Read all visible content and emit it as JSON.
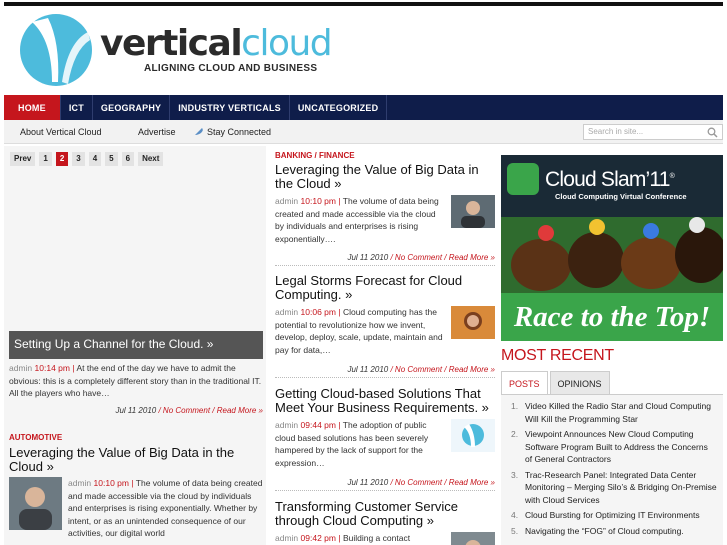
{
  "brand": {
    "word_part1": "vertical",
    "word_part2": "cloud",
    "tagline": "ALIGNING CLOUD AND BUSINESS"
  },
  "nav": {
    "items": [
      {
        "label": "HOME",
        "active": true
      },
      {
        "label": "ICT"
      },
      {
        "label": "GEOGRAPHY"
      },
      {
        "label": "INDUSTRY VERTICALS"
      },
      {
        "label": "UNCATEGORIZED"
      }
    ]
  },
  "subnav": {
    "about": "About Vertical Cloud",
    "advertise": "Advertise",
    "connected": "Stay Connected",
    "search_placeholder": "Search in site..."
  },
  "pager": {
    "prev": "Prev",
    "pages": [
      "1",
      "2",
      "3",
      "4",
      "5",
      "6"
    ],
    "current": "2",
    "next": "Next"
  },
  "slider": {
    "caption": "Setting Up a Channel for the Cloud. »",
    "author": "admin",
    "time": "10:14 pm",
    "excerpt": "At the end of the day we have to admit the obvious: this is a completely different story than in the traditional IT. All the players who have…",
    "date": "Jul 11 2010",
    "comments": "No Comment",
    "read_more": "Read More »"
  },
  "left_post": {
    "category": "AUTOMOTIVE",
    "title": "Leveraging the Value of Big Data in the Cloud »",
    "author": "admin",
    "time": "10:10 pm",
    "excerpt": "The volume of data being created and made accessible via the cloud by individuals and enterprises is rising exponentially. Whether by intent, or as an unintended consequence of our activities, our digital world"
  },
  "center_posts": [
    {
      "category": "BANKING / FINANCE",
      "title": "Leveraging the Value of Big Data in the Cloud »",
      "author": "admin",
      "time": "10:10 pm",
      "excerpt": "The volume of data being created and made accessible via the cloud by individuals and enterprises is rising exponentially….",
      "date": "Jul 11 2010",
      "comments": "No Comment",
      "read_more": "Read More »"
    },
    {
      "title": "Legal Storms Forecast for Cloud Computing. »",
      "author": "admin",
      "time": "10:06 pm",
      "excerpt": "Cloud computing has the potential to revolutionize how we invent, develop, deploy, scale, update, maintain and pay for data,…",
      "date": "Jul 11 2010",
      "comments": "No Comment",
      "read_more": "Read More »"
    },
    {
      "title": "Getting Cloud-based Solutions That Meet Your Business Requirements. »",
      "author": "admin",
      "time": "09:44 pm",
      "excerpt": "The adoption of public cloud based solutions has been severely hampered by the lack of support for the expression…",
      "date": "Jul 11 2010",
      "comments": "No Comment",
      "read_more": "Read More »"
    },
    {
      "title": "Transforming Customer Service through Cloud Computing »",
      "author": "admin",
      "time": "09:42 pm",
      "excerpt": "Building a contact"
    }
  ],
  "ad": {
    "brand": "Cloud Slam’11",
    "reg": "®",
    "subtitle": "Cloud Computing Virtual Conference",
    "slogan": "Race to the Top!"
  },
  "sidebar": {
    "heading": "MOST RECENT",
    "tabs": [
      "POSTS",
      "OPINIONS"
    ],
    "recent": [
      {
        "num": "1.",
        "text": "Video Killed the Radio Star and Cloud Computing Will Kill the Programming Star"
      },
      {
        "num": "2.",
        "text": "Viewpoint Announces New Cloud Computing Software Program Built to Address the Concerns of General Contractors"
      },
      {
        "num": "3.",
        "text": "Trac-Research Panel: Integrated Data Center Monitoring – Merging Silo’s & Bridging On-Premise with Cloud Services"
      },
      {
        "num": "4.",
        "text": "Cloud Bursting for Optimizing IT Environments"
      },
      {
        "num": "5.",
        "text": "Navigating the “FOG” of Cloud computing."
      }
    ]
  },
  "colors": {
    "accent": "#c5161d",
    "nav_bg": "#0f1d4a",
    "brand_blue": "#4dbbdc"
  }
}
